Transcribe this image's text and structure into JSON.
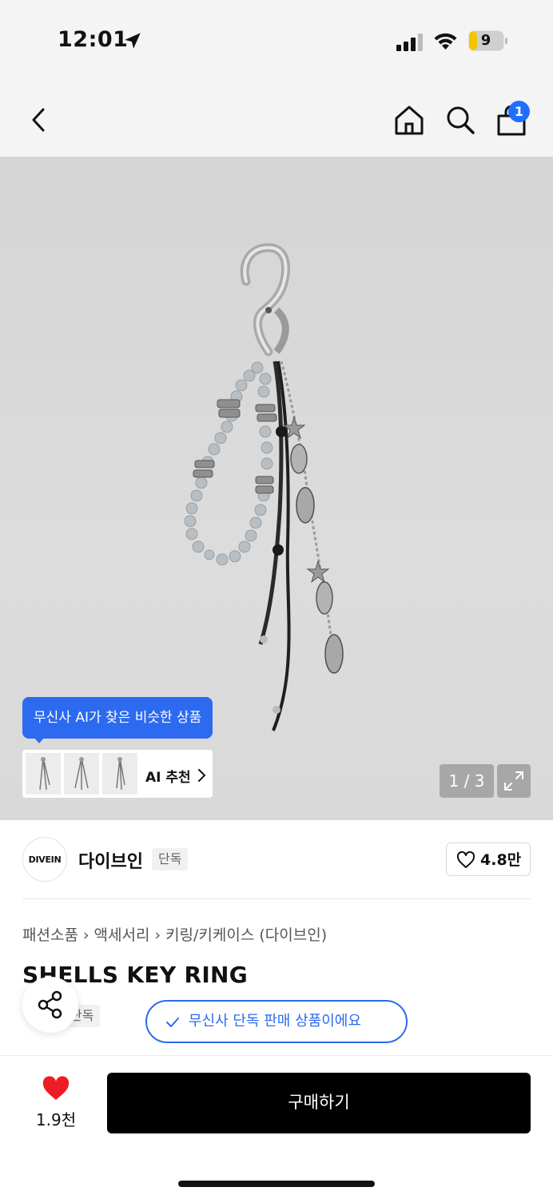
{
  "status_bar": {
    "time": "12:01",
    "battery_level": "9",
    "icons": [
      "location-arrow-icon",
      "cellular-signal-icon",
      "wifi-icon",
      "battery-icon"
    ]
  },
  "nav": {
    "icons": [
      "back-chevron-icon",
      "home-icon",
      "search-icon",
      "cart-icon"
    ],
    "cart_count": "1"
  },
  "product_image": {
    "ai_tooltip": "무신사 AI가 찾은 비슷한 상품",
    "ai_recommend_label": "AI 추천",
    "page_indicator": "1 / 3",
    "expand_icon": "expand-arrows-icon"
  },
  "brand": {
    "logo_text": "DIVEIN",
    "name": "다이브인",
    "tag": "단독"
  },
  "like": {
    "count": "4.8만",
    "icon": "heart-outline-icon"
  },
  "breadcrumb": [
    "패션소품",
    "액세서리",
    "키링/키케이스 (다이브인)"
  ],
  "product": {
    "title": "SHELLS KEY RING",
    "tag": "단독",
    "exclusive_notice": "무신사 단독 판매 상품이에요"
  },
  "bottom_bar": {
    "favorite_count": "1.9천",
    "buy_label": "구매하기"
  },
  "colors": {
    "accent_blue": "#2c6af0",
    "badge_blue": "#1f6fff",
    "heart_red": "#ee1c25",
    "buy_button": "#000000"
  }
}
